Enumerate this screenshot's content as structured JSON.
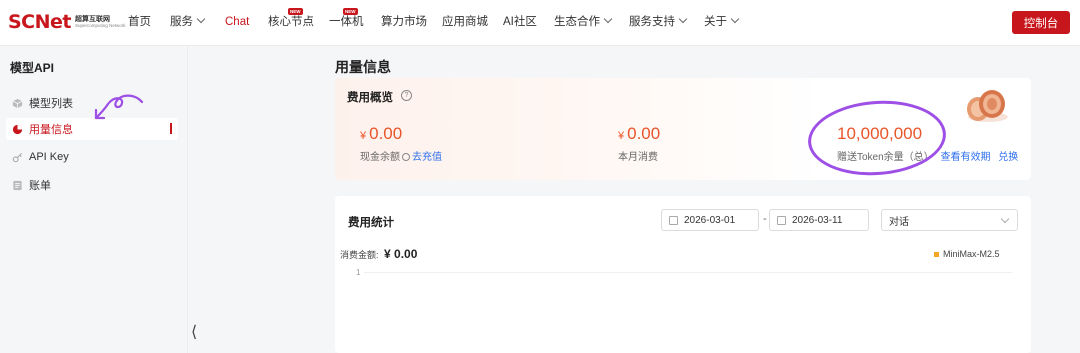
{
  "logo": {
    "mark": "SCNet",
    "cn": "超算互联网",
    "en": "Supercomputing Network"
  },
  "nav": {
    "items": [
      {
        "label": "首页"
      },
      {
        "label": "服务"
      },
      {
        "label": "Chat"
      },
      {
        "label": "核心节点"
      },
      {
        "label": "一体机"
      },
      {
        "label": "算力市场"
      },
      {
        "label": "应用商城"
      },
      {
        "label": "AI社区"
      },
      {
        "label": "生态合作"
      },
      {
        "label": "服务支持"
      },
      {
        "label": "关于"
      }
    ],
    "new_badge": "NEW",
    "console_label": "控制台"
  },
  "sidebar": {
    "title": "模型API",
    "items": [
      {
        "label": "模型列表"
      },
      {
        "label": "用量信息"
      },
      {
        "label": "API Key"
      },
      {
        "label": "账单"
      }
    ],
    "collapse_glyph": "⟨"
  },
  "page": {
    "title": "用量信息"
  },
  "overview": {
    "title": "费用概览",
    "help": "?",
    "cash": {
      "currency": "¥",
      "amount": "0.00",
      "label": "现金余额",
      "link": "去充值"
    },
    "monthly": {
      "currency": "¥",
      "amount": "0.00",
      "label": "本月消费"
    },
    "tokens": {
      "amount": "10,000,000",
      "label": "赠送Token余量（总）",
      "link1": "查看有效期",
      "link2": "兑换"
    }
  },
  "stats": {
    "title": "费用统计",
    "date_start": "2026-03-01",
    "date_sep": "-",
    "date_end": "2026-03-11",
    "type_select": "对话",
    "spend_label": "消费金额:",
    "spend_value": "¥ 0.00",
    "legend": "MiniMax-M2.5",
    "y_tick": "1"
  },
  "colors": {
    "brand": "#c8161d",
    "amount": "#e8552a",
    "link": "#2f6fed",
    "annotation": "#9d4fe6",
    "legend": "#f5a623"
  }
}
